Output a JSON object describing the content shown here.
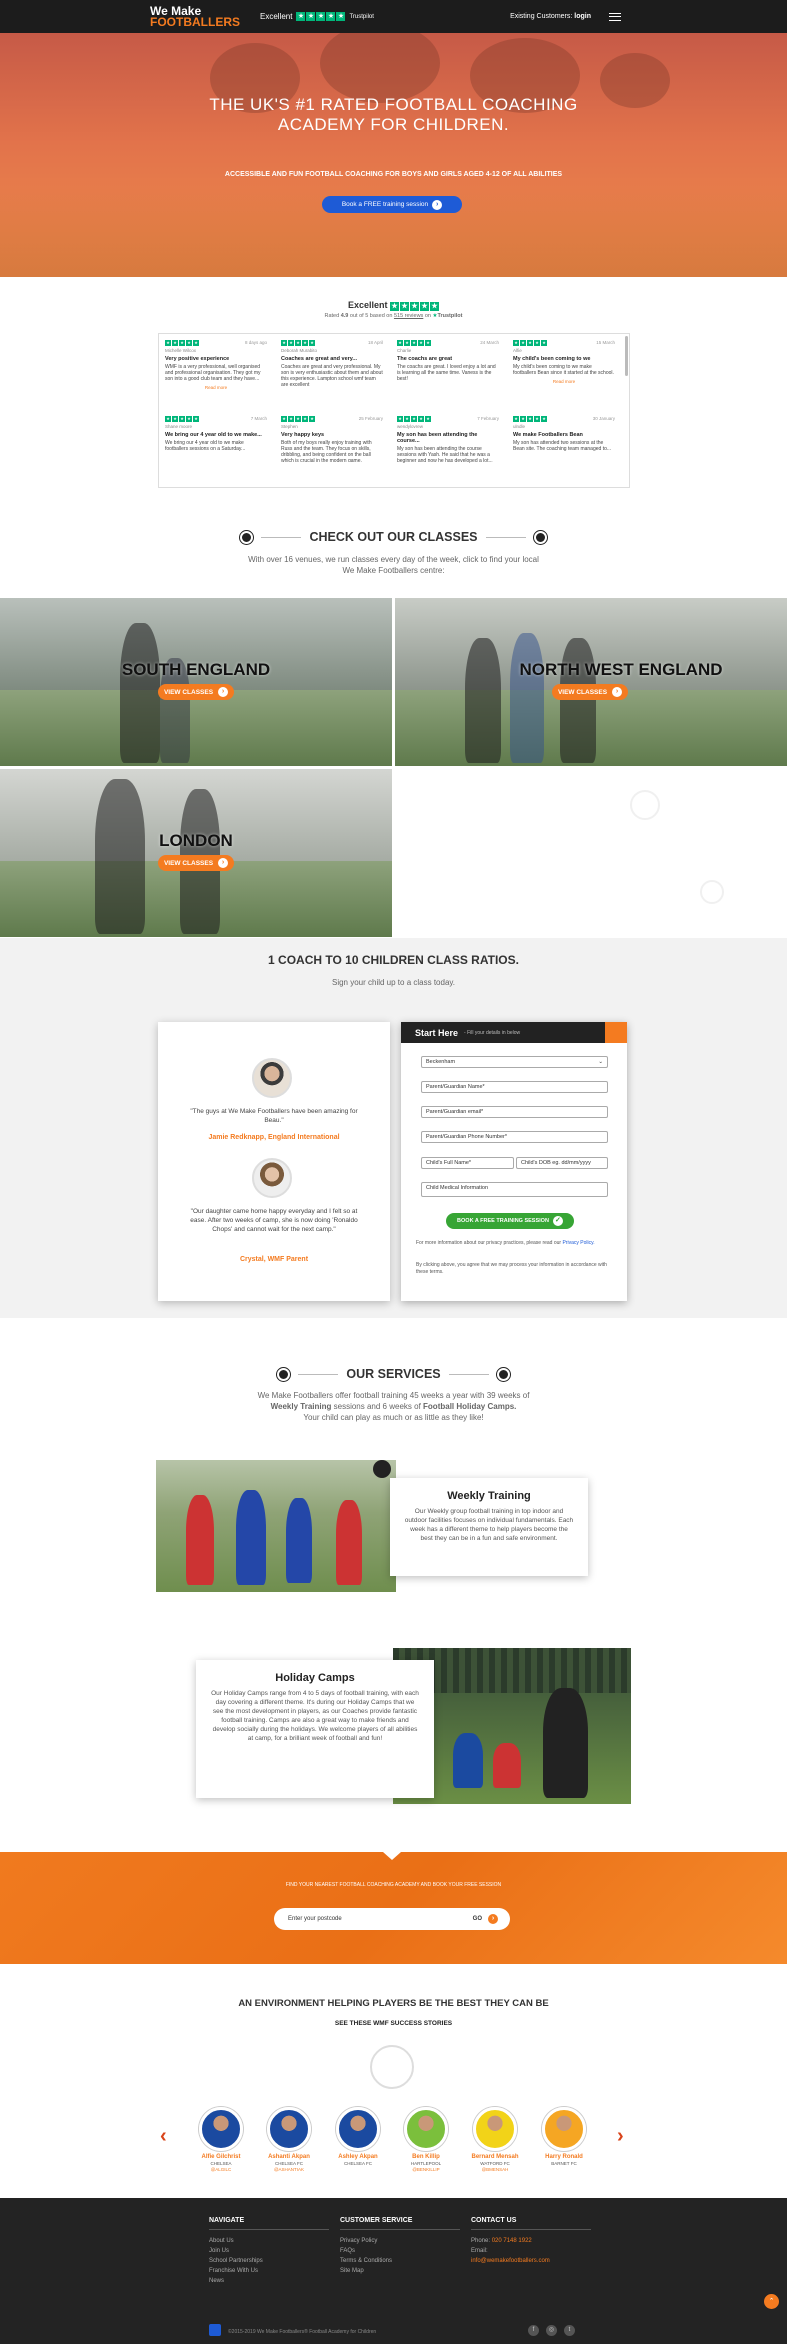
{
  "header": {
    "logo_line1": "We Make",
    "logo_line2": "FOOTBALLERS",
    "trust_label": "Excellent",
    "trust_brand": "Trustpilot",
    "existing_label": "Existing Customers:",
    "login_label": "login"
  },
  "hero": {
    "title_line1": "THE UK'S #1 RATED FOOTBALL COACHING",
    "title_line2": "ACADEMY FOR CHILDREN.",
    "subtitle": "ACCESSIBLE AND FUN FOOTBALL COACHING FOR BOYS AND GIRLS AGED 4-12 OF ALL ABILITIES",
    "cta": "Book a FREE training session"
  },
  "trustpilot": {
    "title": "Excellent",
    "rated_prefix": "Rated",
    "score": "4.9",
    "rated_mid": "out of 5 based on",
    "reviews_count": "515 reviews",
    "rated_suffix": "on",
    "brand": "Trustpilot",
    "reviews": [
      {
        "col": 0,
        "date": "8 days ago",
        "name": "Michelle Wilcox",
        "title": "Very positive experience",
        "text": "WMF is a very professional, well organised and professional organisation. They got my son into a good club team and they have...",
        "read_more": "Read more"
      },
      {
        "col": 0,
        "date": "7 March",
        "name": "Shane moore",
        "title": "We bring our 4 year old to we make...",
        "text": "We bring our 4 year old to we make footballers sessions on a Saturday...",
        "read_more": ""
      },
      {
        "col": 1,
        "date": "18 April",
        "name": "Deborah Murabito",
        "title": "Coaches are great and very...",
        "text": "Coaches are great and very professional. My son is very enthusiastic about them and about this experience. Lampton school wmf team are excellent",
        "read_more": ""
      },
      {
        "col": 1,
        "date": "25 February",
        "name": "Stephen",
        "title": "Very happy keys",
        "text": "Both of my boys really enjoy training with Russ and the team. They focus on skills, dribbling, and being confident on the ball which is crucial in the modern game.",
        "read_more": ""
      },
      {
        "col": 2,
        "date": "24 March",
        "name": "Charlie",
        "title": "The coachs are great",
        "text": "The coachs are great. I loved enjoy a lot and is learning all the same time. Vaness is the best!",
        "read_more": ""
      },
      {
        "col": 2,
        "date": "7 February",
        "name": "wendylovrew",
        "title": "My son has been attending the course...",
        "text": "My son has been attending the course sessions with Yash. He said that he was a beginner and now he has developed a lot...",
        "read_more": ""
      },
      {
        "col": 3,
        "date": "15 March",
        "name": "Alfie",
        "title": "My child's been coming to we",
        "text": "My child's been coming to we make footballers Bean since it started at the school.",
        "read_more": "Read more"
      },
      {
        "col": 3,
        "date": "30 January",
        "name": "ulndle",
        "title": "We make Footballers Bean",
        "text": "My son has attended two sessions at the Bean site. The coaching team managed to...",
        "read_more": ""
      }
    ]
  },
  "classes": {
    "title": "CHECK OUT OUR CLASSES",
    "desc_line1": "With over 16 venues, we run classes every day of the week, click to find your local",
    "desc_line2": "We Make Footballers centre:",
    "regions": [
      {
        "name": "SOUTH ENGLAND",
        "button": "VIEW CLASSES"
      },
      {
        "name": "NORTH WEST ENGLAND",
        "button": "VIEW CLASSES"
      },
      {
        "name": "LONDON",
        "button": "VIEW CLASSES"
      }
    ]
  },
  "ratio": {
    "title": "1 COACH TO 10 CHILDREN CLASS RATIOS.",
    "subtitle": "Sign your child up to a class today.",
    "testimonials": [
      {
        "quote": "\"The guys at We Make Footballers have been amazing for Beau.\"",
        "name": "Jamie Redknapp, England International"
      },
      {
        "quote": "\"Our daughter came home happy everyday and I felt so at ease. After two weeks of camp, she is now doing 'Ronaldo Chops' and cannot wait for the next camp.\"",
        "name": "Crystal, WMF Parent"
      }
    ]
  },
  "form": {
    "title": "Start Here",
    "hint": "- Fill your details in below",
    "venue": "Beckenham",
    "parent_name": "Parent/Guardian Name*",
    "parent_email": "Parent/Guardian email*",
    "parent_phone": "Parent/Guardian Phone Number*",
    "child_name": "Child's Full Name*",
    "child_dob": "Child's DOB eg. dd/mm/yyyy",
    "medical": "Child Medical Information",
    "submit": "BOOK A FREE TRAINING SESSION",
    "privacy_text": "For more information about our privacy practices, please read our",
    "privacy_link": "Privacy Policy.",
    "consent_text": "By clicking above, you agree that we may process your information in accordance with these terms."
  },
  "services": {
    "title": "OUR SERVICES",
    "desc_line1": "We Make Footballers offer football training 45 weeks a year with 39 weeks of",
    "desc_b1": "Weekly Training",
    "desc_mid": "sessions and 6 weeks of",
    "desc_b2": "Football Holiday Camps.",
    "desc_line3": "Your child can play as much or as little as they like!",
    "weekly_title": "Weekly Training",
    "weekly_text": "Our Weekly group football training in top indoor and outdoor facilities focuses on individual fundamentals. Each week has a different theme to help players become the best they can be in a fun and safe environment.",
    "holiday_title": "Holiday Camps",
    "holiday_text": "Our Holiday Camps range from 4 to 5 days of football training, with each day covering a different theme. It's during our Holiday Camps that we see the most development in players, as our Coaches provide fantastic football training. Camps are also a great way to make friends and develop socially during the holidays. We welcome players of all abilities at camp, for a brilliant week of football and fun!"
  },
  "postcode": {
    "label": "FIND YOUR NEAREST FOOTBALL COACHING ACADEMY AND BOOK YOUR FREE SESSION",
    "placeholder": "Enter your postcode",
    "go": "GO"
  },
  "success": {
    "title": "AN ENVIRONMENT HELPING PLAYERS BE THE BEST THEY CAN BE",
    "subtitle": "SEE THESE WMF SUCCESS STORIES",
    "players": [
      {
        "name": "Alfie Gilchrist",
        "club": "CHELSEA",
        "handle": "@ALGILC",
        "color": "#1b4aa0"
      },
      {
        "name": "Ashanti Akpan",
        "club": "CHELSEA FC",
        "handle": "@ASHANTIAK",
        "color": "#1b4aa0"
      },
      {
        "name": "Ashley Akpan",
        "club": "CHELSEA FC",
        "handle": "",
        "color": "#1b4aa0"
      },
      {
        "name": "Ben Killip",
        "club": "HARTLEPOOL",
        "handle": "@BENKILLIP",
        "color": "#7bbf3c"
      },
      {
        "name": "Bernard Mensah",
        "club": "WATFORD FC",
        "handle": "@BMENSAH",
        "color": "#f2d318"
      },
      {
        "name": "Harry Ronald",
        "club": "BARNET FC",
        "handle": "",
        "color": "#f5a623"
      }
    ]
  },
  "footer": {
    "navigate_title": "NAVIGATE",
    "navigate": [
      "About Us",
      "Join Us",
      "School Partnerships",
      "Franchise With Us",
      "News"
    ],
    "service_title": "CUSTOMER SERVICE",
    "service": [
      "Privacy Policy",
      "FAQs",
      "Terms & Conditions",
      "Site Map"
    ],
    "contact_title": "CONTACT US",
    "phone_label": "Phone:",
    "phone": "020 7148 1922",
    "email_label": "Email:",
    "email": "info@wemakefootballers.com",
    "copyright": "©2015-2019 We Make Footballers® Football Academy for Children",
    "social": [
      "f",
      "◎",
      "t"
    ]
  },
  "colors": {
    "accent": "#f47b20",
    "dark": "#1c1c1c",
    "trust": "#00b67a",
    "cta_blue": "#1e5bd6",
    "green": "#37a535"
  }
}
